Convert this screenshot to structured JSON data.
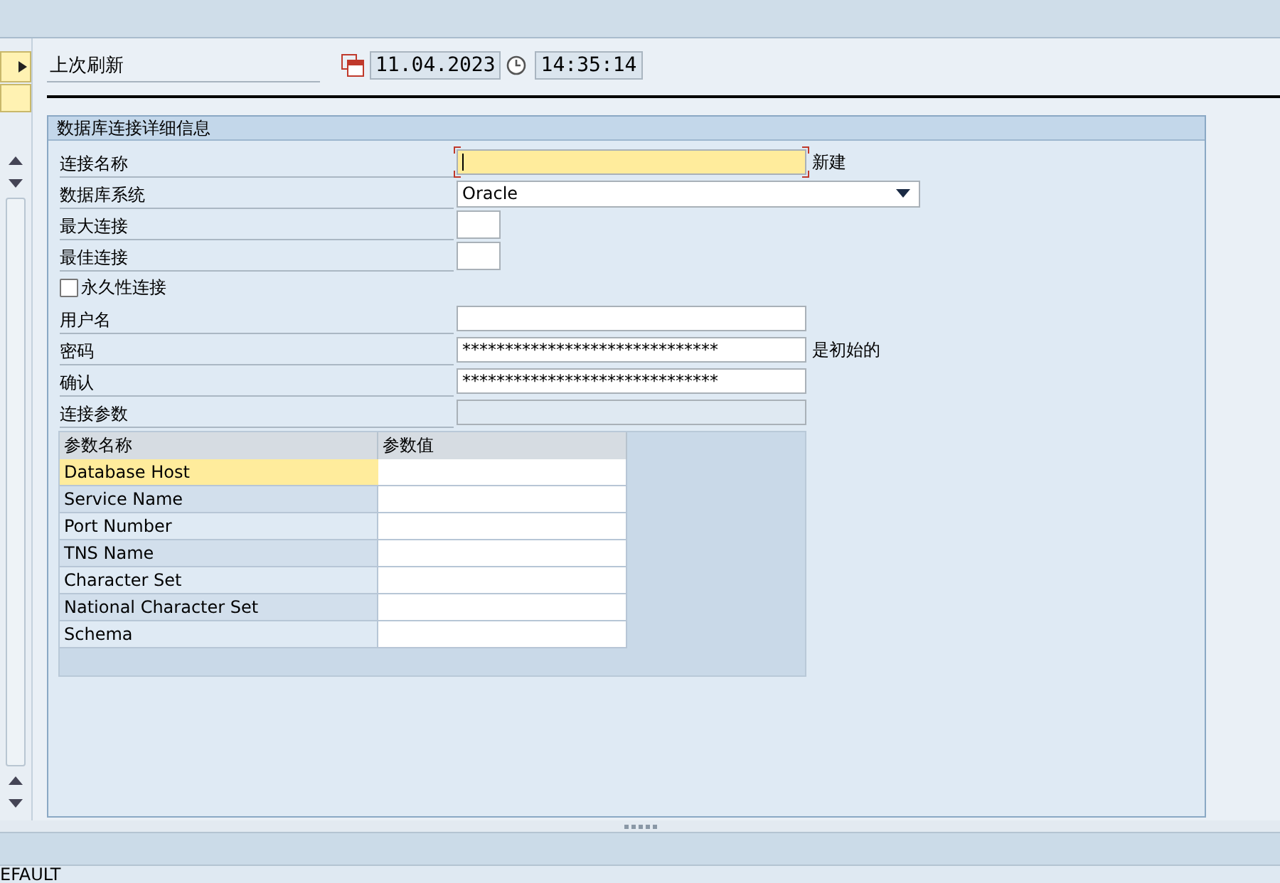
{
  "header": {
    "label": "上次刷新",
    "date": "11.04.2023",
    "time": "14:35:14"
  },
  "group": {
    "title": "数据库连接详细信息",
    "rows": [
      {
        "kind": "text",
        "label": "连接名称",
        "value": "",
        "wide": true,
        "focused": true,
        "disabled": false,
        "note": "新建"
      },
      {
        "kind": "select",
        "label": "数据库系统",
        "value": "Oracle"
      },
      {
        "kind": "text",
        "label": "最大连接",
        "value": "",
        "wide": false,
        "focused": false,
        "disabled": false
      },
      {
        "kind": "text",
        "label": "最佳连接",
        "value": "",
        "wide": false,
        "focused": false,
        "disabled": false
      },
      {
        "kind": "checkbox",
        "label": "永久性连接",
        "checked": false
      },
      {
        "kind": "text",
        "label": "用户名",
        "value": "",
        "wide": true,
        "focused": false,
        "disabled": false
      },
      {
        "kind": "text",
        "label": "密码",
        "value": "******************************",
        "wide": true,
        "focused": false,
        "disabled": false,
        "note": "是初始的"
      },
      {
        "kind": "text",
        "label": "确认",
        "value": "******************************",
        "wide": true,
        "focused": false,
        "disabled": false
      },
      {
        "kind": "text",
        "label": "连接参数",
        "value": "",
        "wide": true,
        "focused": false,
        "disabled": true
      }
    ],
    "table": {
      "columns": [
        "参数名称",
        "参数值"
      ],
      "rows": [
        {
          "name": "Database Host",
          "value": "",
          "selected": true
        },
        {
          "name": "Service Name",
          "value": "",
          "selected": false
        },
        {
          "name": "Port Number",
          "value": "",
          "selected": false
        },
        {
          "name": "TNS Name",
          "value": "",
          "selected": false
        },
        {
          "name": "Character Set",
          "value": "",
          "selected": false
        },
        {
          "name": "National Character Set",
          "value": "",
          "selected": false
        },
        {
          "name": "Schema",
          "value": "",
          "selected": false
        }
      ]
    }
  },
  "status_bar": {
    "text": "EFAULT"
  }
}
